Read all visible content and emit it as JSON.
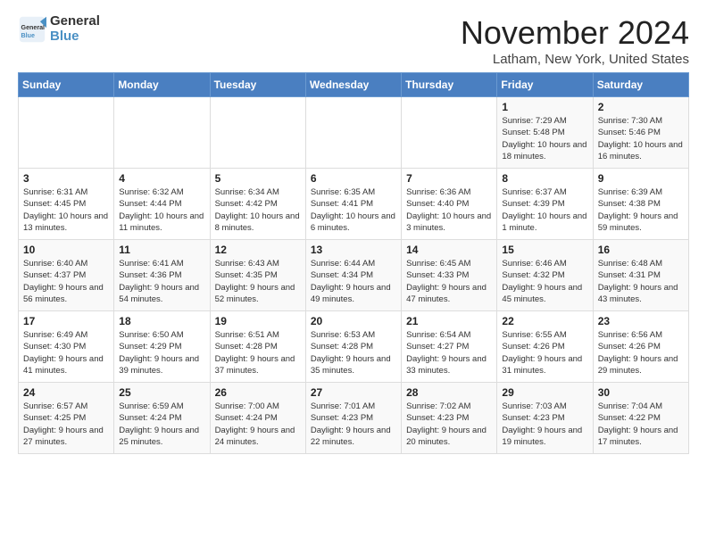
{
  "logo": {
    "general": "General",
    "blue": "Blue"
  },
  "title": "November 2024",
  "location": "Latham, New York, United States",
  "days_of_week": [
    "Sunday",
    "Monday",
    "Tuesday",
    "Wednesday",
    "Thursday",
    "Friday",
    "Saturday"
  ],
  "weeks": [
    [
      {
        "day": "",
        "info": ""
      },
      {
        "day": "",
        "info": ""
      },
      {
        "day": "",
        "info": ""
      },
      {
        "day": "",
        "info": ""
      },
      {
        "day": "",
        "info": ""
      },
      {
        "day": "1",
        "info": "Sunrise: 7:29 AM\nSunset: 5:48 PM\nDaylight: 10 hours and 18 minutes."
      },
      {
        "day": "2",
        "info": "Sunrise: 7:30 AM\nSunset: 5:46 PM\nDaylight: 10 hours and 16 minutes."
      }
    ],
    [
      {
        "day": "3",
        "info": "Sunrise: 6:31 AM\nSunset: 4:45 PM\nDaylight: 10 hours and 13 minutes."
      },
      {
        "day": "4",
        "info": "Sunrise: 6:32 AM\nSunset: 4:44 PM\nDaylight: 10 hours and 11 minutes."
      },
      {
        "day": "5",
        "info": "Sunrise: 6:34 AM\nSunset: 4:42 PM\nDaylight: 10 hours and 8 minutes."
      },
      {
        "day": "6",
        "info": "Sunrise: 6:35 AM\nSunset: 4:41 PM\nDaylight: 10 hours and 6 minutes."
      },
      {
        "day": "7",
        "info": "Sunrise: 6:36 AM\nSunset: 4:40 PM\nDaylight: 10 hours and 3 minutes."
      },
      {
        "day": "8",
        "info": "Sunrise: 6:37 AM\nSunset: 4:39 PM\nDaylight: 10 hours and 1 minute."
      },
      {
        "day": "9",
        "info": "Sunrise: 6:39 AM\nSunset: 4:38 PM\nDaylight: 9 hours and 59 minutes."
      }
    ],
    [
      {
        "day": "10",
        "info": "Sunrise: 6:40 AM\nSunset: 4:37 PM\nDaylight: 9 hours and 56 minutes."
      },
      {
        "day": "11",
        "info": "Sunrise: 6:41 AM\nSunset: 4:36 PM\nDaylight: 9 hours and 54 minutes."
      },
      {
        "day": "12",
        "info": "Sunrise: 6:43 AM\nSunset: 4:35 PM\nDaylight: 9 hours and 52 minutes."
      },
      {
        "day": "13",
        "info": "Sunrise: 6:44 AM\nSunset: 4:34 PM\nDaylight: 9 hours and 49 minutes."
      },
      {
        "day": "14",
        "info": "Sunrise: 6:45 AM\nSunset: 4:33 PM\nDaylight: 9 hours and 47 minutes."
      },
      {
        "day": "15",
        "info": "Sunrise: 6:46 AM\nSunset: 4:32 PM\nDaylight: 9 hours and 45 minutes."
      },
      {
        "day": "16",
        "info": "Sunrise: 6:48 AM\nSunset: 4:31 PM\nDaylight: 9 hours and 43 minutes."
      }
    ],
    [
      {
        "day": "17",
        "info": "Sunrise: 6:49 AM\nSunset: 4:30 PM\nDaylight: 9 hours and 41 minutes."
      },
      {
        "day": "18",
        "info": "Sunrise: 6:50 AM\nSunset: 4:29 PM\nDaylight: 9 hours and 39 minutes."
      },
      {
        "day": "19",
        "info": "Sunrise: 6:51 AM\nSunset: 4:28 PM\nDaylight: 9 hours and 37 minutes."
      },
      {
        "day": "20",
        "info": "Sunrise: 6:53 AM\nSunset: 4:28 PM\nDaylight: 9 hours and 35 minutes."
      },
      {
        "day": "21",
        "info": "Sunrise: 6:54 AM\nSunset: 4:27 PM\nDaylight: 9 hours and 33 minutes."
      },
      {
        "day": "22",
        "info": "Sunrise: 6:55 AM\nSunset: 4:26 PM\nDaylight: 9 hours and 31 minutes."
      },
      {
        "day": "23",
        "info": "Sunrise: 6:56 AM\nSunset: 4:26 PM\nDaylight: 9 hours and 29 minutes."
      }
    ],
    [
      {
        "day": "24",
        "info": "Sunrise: 6:57 AM\nSunset: 4:25 PM\nDaylight: 9 hours and 27 minutes."
      },
      {
        "day": "25",
        "info": "Sunrise: 6:59 AM\nSunset: 4:24 PM\nDaylight: 9 hours and 25 minutes."
      },
      {
        "day": "26",
        "info": "Sunrise: 7:00 AM\nSunset: 4:24 PM\nDaylight: 9 hours and 24 minutes."
      },
      {
        "day": "27",
        "info": "Sunrise: 7:01 AM\nSunset: 4:23 PM\nDaylight: 9 hours and 22 minutes."
      },
      {
        "day": "28",
        "info": "Sunrise: 7:02 AM\nSunset: 4:23 PM\nDaylight: 9 hours and 20 minutes."
      },
      {
        "day": "29",
        "info": "Sunrise: 7:03 AM\nSunset: 4:23 PM\nDaylight: 9 hours and 19 minutes."
      },
      {
        "day": "30",
        "info": "Sunrise: 7:04 AM\nSunset: 4:22 PM\nDaylight: 9 hours and 17 minutes."
      }
    ]
  ]
}
